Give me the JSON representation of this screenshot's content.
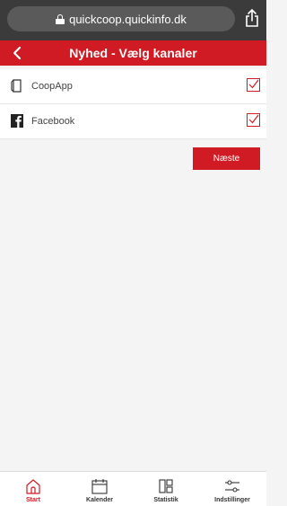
{
  "browser": {
    "url": "quickcoop.quickinfo.dk",
    "icons": {
      "lock": "lock-icon",
      "share": "share-icon"
    }
  },
  "header": {
    "title": "Nyhed - Vælg kanaler",
    "back_icon": "chevron-left-icon",
    "color": "#d01a24"
  },
  "channels": [
    {
      "label": "CoopApp",
      "icon": "phone-icon",
      "checked": true
    },
    {
      "label": "Facebook",
      "icon": "facebook-icon",
      "checked": true
    }
  ],
  "next_button": {
    "label": "Næste"
  },
  "tabs": [
    {
      "label": "Start",
      "icon": "home-icon",
      "active": true
    },
    {
      "label": "Kalender",
      "icon": "calendar-icon",
      "active": false
    },
    {
      "label": "Statistik",
      "icon": "statistics-icon",
      "active": false
    },
    {
      "label": "Indstillinger",
      "icon": "sliders-icon",
      "active": false
    }
  ],
  "colors": {
    "accent": "#d01a24",
    "browser_bar": "#3b3b3b",
    "background": "#f4f4f4"
  }
}
